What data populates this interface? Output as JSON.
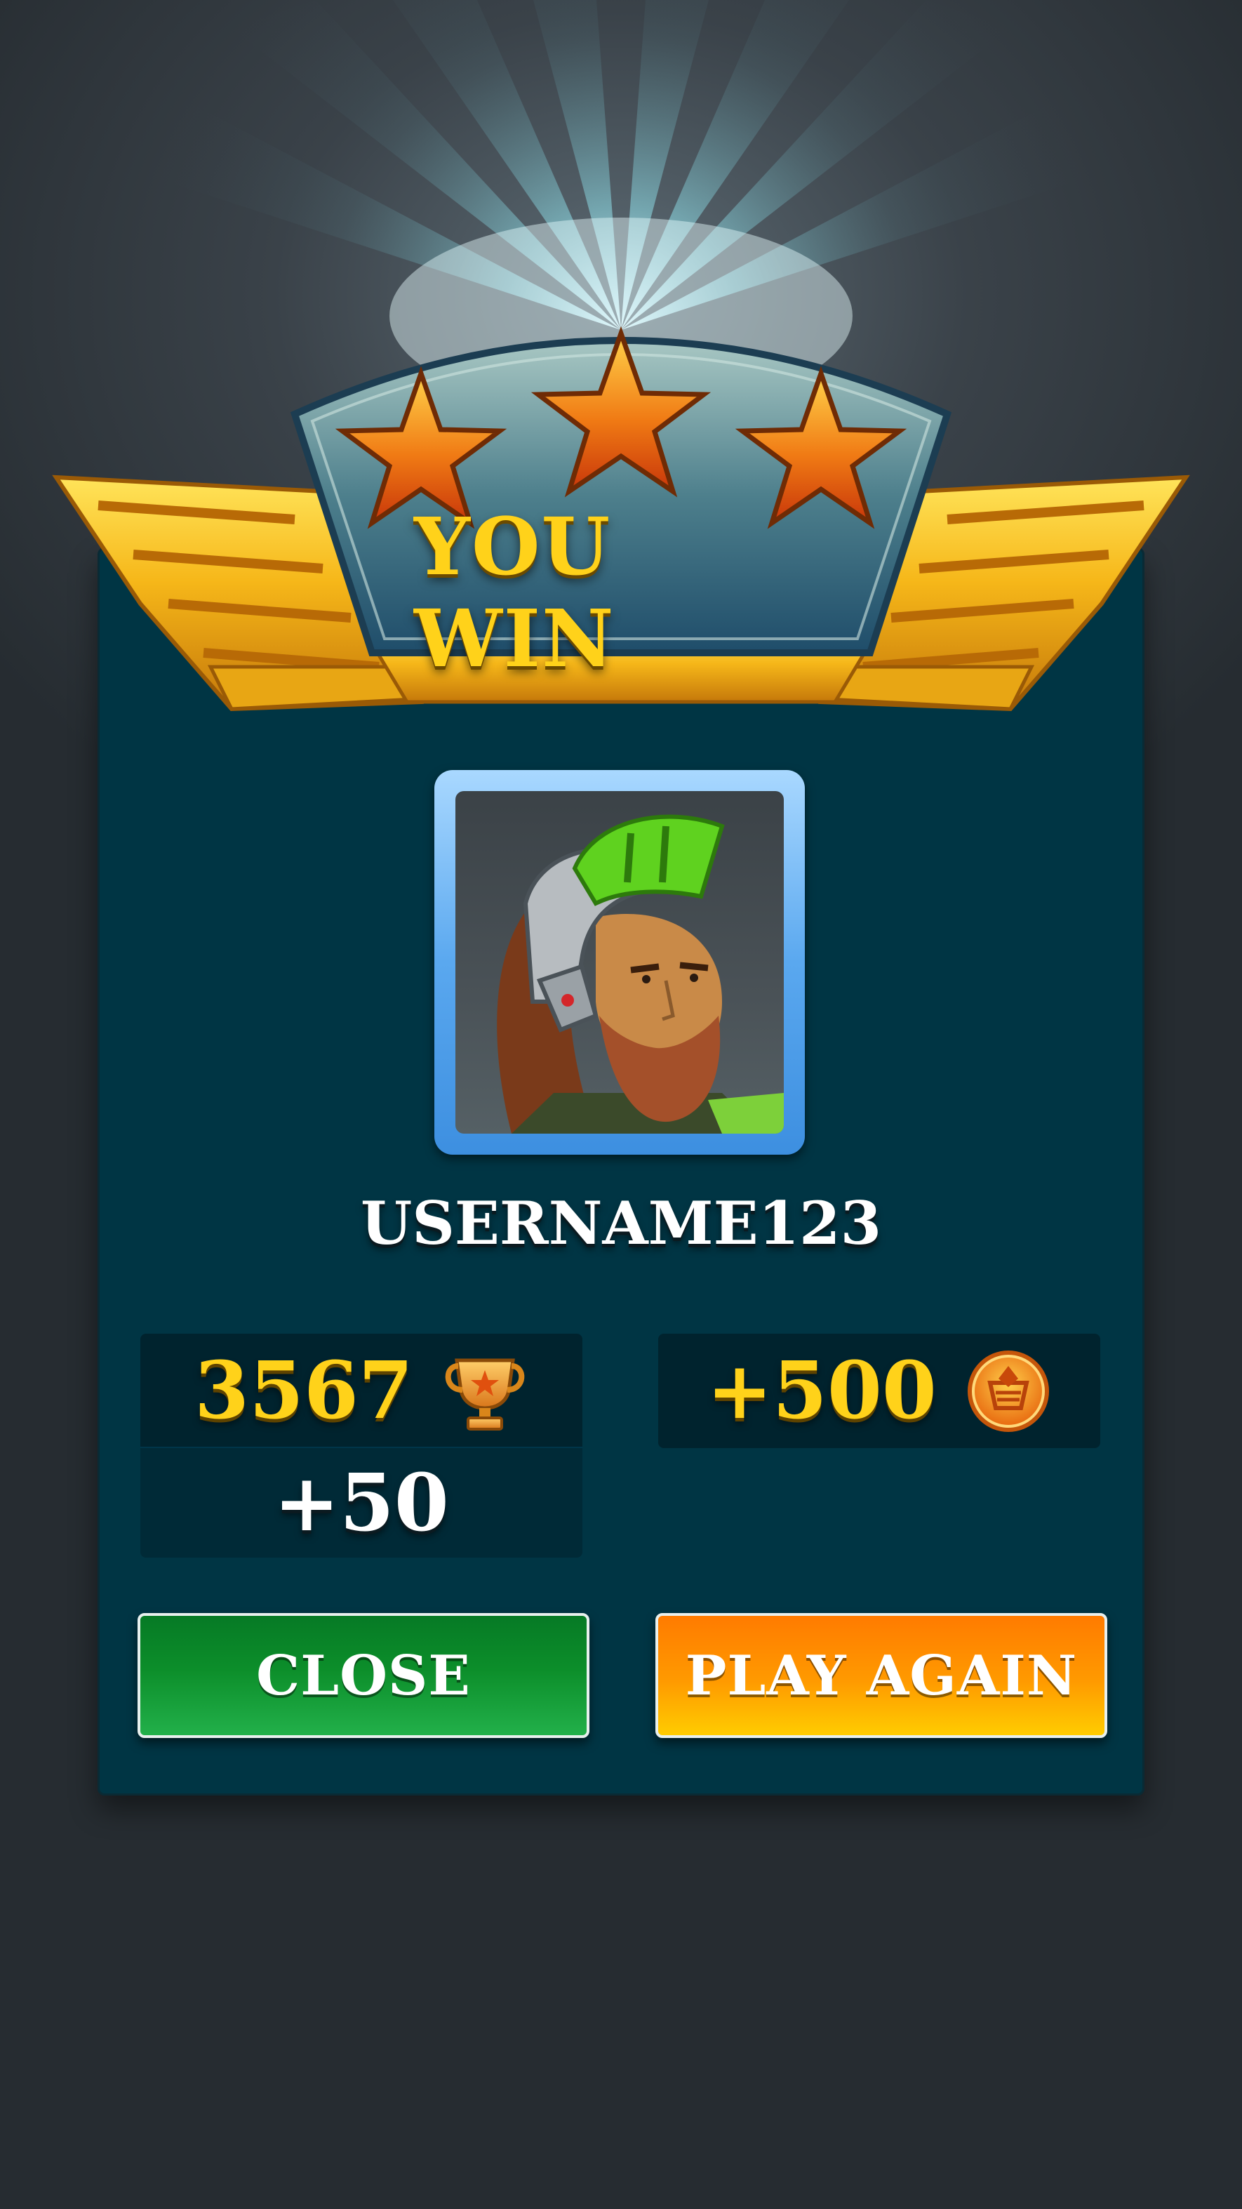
{
  "header": {
    "title": "YOU WIN",
    "stars_earned": 3,
    "stars_total": 3
  },
  "player": {
    "username": "USERNAME123",
    "avatar": "bearded-warrior-avatar"
  },
  "stats": {
    "trophies": "3567",
    "trophy_icon": "trophy-icon",
    "trophy_delta": "+50",
    "coins_delta": "+500",
    "coin_icon": "coin-icon"
  },
  "buttons": {
    "close_label": "CLOSE",
    "play_again_label": "PLAY AGAIN"
  },
  "colors": {
    "panel": "#003544",
    "title_gold": "#ffd21a",
    "close_green": "#0c8e2a",
    "play_orange": "#ff9a00",
    "avatar_frame_blue": "#5aa8ef"
  }
}
